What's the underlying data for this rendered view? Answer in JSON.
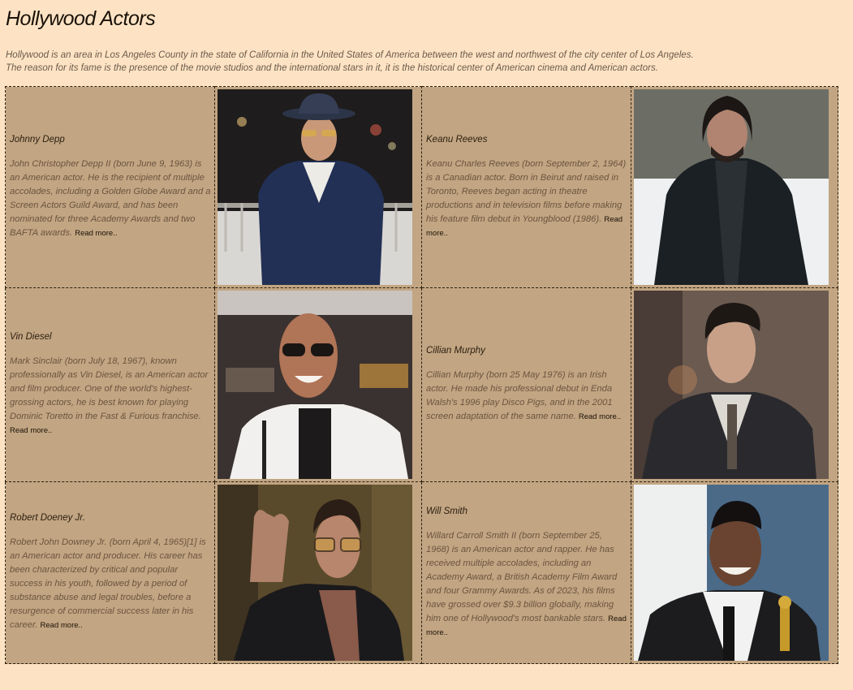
{
  "page": {
    "title": "Hollywood Actors",
    "intro_line1": "Hollywood is an area in Los Angeles County in the state of California in the United States of America between the west and northwest of the city center of Los Angeles.",
    "intro_line2": "The reason for its fame is the presence of the movie studios and the international stars in it, it is the historical center of American cinema and American actors."
  },
  "actors": [
    {
      "name": "Johnny Depp",
      "bio": "John Christopher Depp II (born June 9, 1963) is an American actor. He is the recipient of multiple accolades, including a Golden Globe Award and a Screen Actors Guild Award, and has been nominated for three Academy Awards and two BAFTA awards.",
      "read_more": "Read more.."
    },
    {
      "name": "Keanu Reeves",
      "bio": "Keanu Charles Reeves (born September 2, 1964) is a Canadian actor. Born in Beirut and raised in Toronto, Reeves began acting in theatre productions and in television films before making his feature film debut in Youngblood (1986).",
      "read_more": "Read more.."
    },
    {
      "name": "Vin Diesel",
      "bio": "Mark Sinclair (born July 18, 1967), known professionally as Vin Diesel, is an American actor and film producer. One of the world's highest-grossing actors, he is best known for playing Dominic Toretto in the Fast & Furious franchise.",
      "read_more": "Read more.."
    },
    {
      "name": "Cillian Murphy",
      "bio": "Cillian Murphy (born 25 May 1976) is an Irish actor. He made his professional debut in Enda Walsh's 1996 play Disco Pigs, and in the 2001 screen adaptation of the same name.",
      "read_more": "Read more.."
    },
    {
      "name": "Robert Doeney Jr.",
      "bio": "Robert John Downey Jr. (born April 4, 1965)[1] is an American actor and producer. His career has been characterized by critical and popular success in his youth, followed by a period of substance abuse and legal troubles, before a resurgence of commercial success later in his career.",
      "read_more": "Read more.."
    },
    {
      "name": "Will Smith",
      "bio": "Willard Carroll Smith II (born September 25, 1968) is an American actor and rapper. He has received multiple accolades, including an Academy Award, a British Academy Film Award and four Grammy Awards. As of 2023, his films have grossed over $9.3 billion globally, making him one of Hollywood's most bankable stars.",
      "read_more": "Read more.."
    }
  ],
  "colors": {
    "page_background": "#fde3c4",
    "cell_background": "#c2a582",
    "border": "#2a2010"
  }
}
